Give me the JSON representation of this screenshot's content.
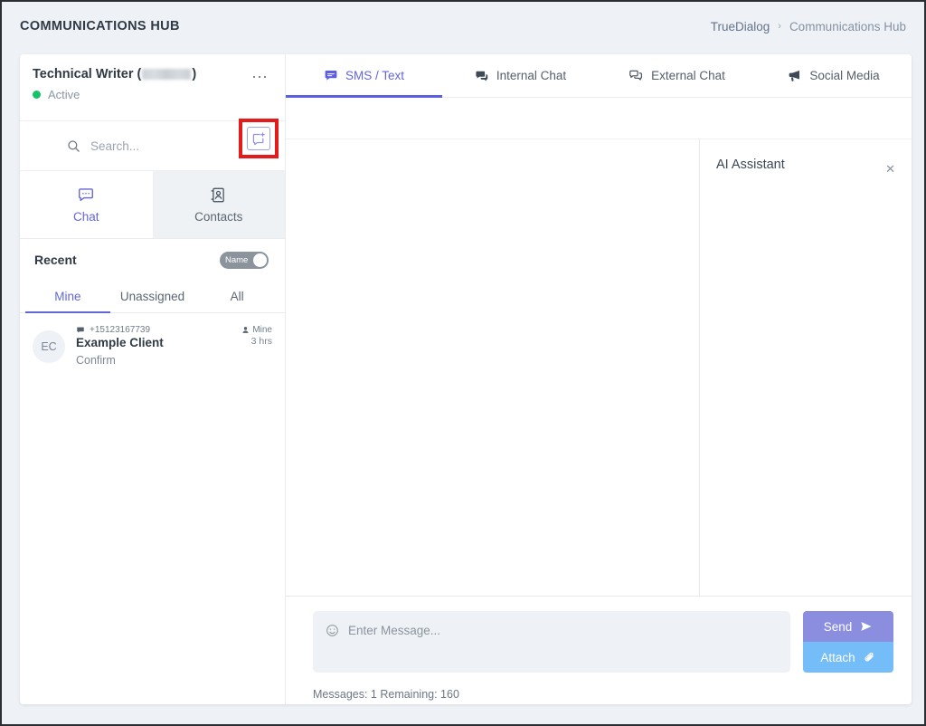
{
  "header": {
    "app_title": "COMMUNICATIONS HUB",
    "breadcrumb": {
      "root": "TrueDialog",
      "separator": "›",
      "current": "Communications Hub"
    }
  },
  "sidebar": {
    "user": {
      "name_prefix": "Technical Writer (",
      "name_suffix": ")",
      "status": "Active",
      "status_color": "#15c26b",
      "menu_icon": "kebab-menu-icon"
    },
    "search": {
      "placeholder": "Search...",
      "icon": "search-icon"
    },
    "compose": {
      "icon": "new-message-icon",
      "highlight_color": "#e51b1b"
    },
    "tabs": [
      {
        "label": "Chat",
        "icon": "chat-bubble-icon",
        "active": true
      },
      {
        "label": "Contacts",
        "icon": "contact-card-icon",
        "active": false
      }
    ],
    "recent": {
      "label": "Recent",
      "toggle_label": "Name"
    },
    "filters": [
      {
        "label": "Mine",
        "active": true
      },
      {
        "label": "Unassigned",
        "active": false
      },
      {
        "label": "All",
        "active": false
      }
    ],
    "conversations": [
      {
        "initials": "EC",
        "phone": "+15123167739",
        "name": "Example Client",
        "preview": "Confirm",
        "assignment": "Mine",
        "time": "3 hrs"
      }
    ]
  },
  "main": {
    "tabs": [
      {
        "label": "SMS / Text",
        "icon": "sms-bubble-icon",
        "active": true
      },
      {
        "label": "Internal Chat",
        "icon": "double-bubble-icon",
        "active": false
      },
      {
        "label": "External Chat",
        "icon": "outline-bubbles-icon",
        "active": false
      },
      {
        "label": "Social Media",
        "icon": "megaphone-icon",
        "active": false
      }
    ],
    "ai_assistant": {
      "title": "AI Assistant",
      "close_icon": "close-icon"
    },
    "composer": {
      "emoji_icon": "emoji-smiley-icon",
      "placeholder": "Enter Message...",
      "send_label": "Send",
      "send_icon": "send-arrow-icon",
      "send_color": "#8b8ede",
      "attach_label": "Attach",
      "attach_icon": "paperclip-icon",
      "attach_color": "#74bdf8",
      "counter": "Messages: 1 Remaining: 160"
    }
  }
}
